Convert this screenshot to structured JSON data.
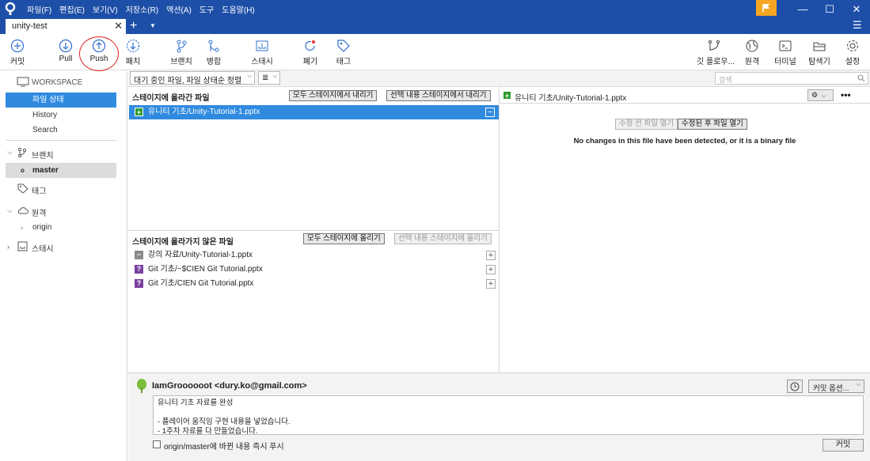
{
  "menu": [
    "파일(F)",
    "편집(E)",
    "보기(V)",
    "저장소(R)",
    "액션(A)",
    "도구",
    "도움말(H)"
  ],
  "window": {
    "minimize": "—",
    "maximize": "☐",
    "close": "✕"
  },
  "tab": {
    "title": "unity-test",
    "close": "✕",
    "add": "+",
    "dropdown": "▼"
  },
  "toolbar": {
    "commit": "커밋",
    "pull": "Pull",
    "push": "Push",
    "fetch": "패치",
    "branch": "브랜치",
    "merge": "병합",
    "stash": "스태시",
    "discard": "폐기",
    "tag": "태그",
    "gitflow": "깃 플로우...",
    "remote": "원격",
    "terminal": "터미널",
    "explorer": "탐색기",
    "settings": "설정"
  },
  "sidebar": {
    "workspace": "WORKSPACE",
    "file_status": "파일 상태",
    "history": "History",
    "search": "Search",
    "branches": "브랜치",
    "master": "master",
    "tags": "태그",
    "remotes": "원격",
    "origin": "origin",
    "stashes": "스태시"
  },
  "filter": {
    "mode": "대기 중인 파일, 파일 상태순 정렬",
    "view": "≣",
    "search_placeholder": "검색"
  },
  "staged": {
    "header": "스테이지에 올라간 파일",
    "unstage_all": "모두 스테이지에서 내리기",
    "unstage_selected": "선택 내용 스테이지에서 내리기",
    "files": [
      {
        "name": "유니티 기초/Unity-Tutorial-1.pptx",
        "status": "added"
      }
    ]
  },
  "unstaged": {
    "header": "스테이지에 올라가지 않은 파일",
    "stage_all": "모두 스테이지에 올리기",
    "stage_selected": "선택 내용 스테이지에 올리기",
    "files": [
      {
        "name": "강의 자료/Unity-Tutorial-1.pptx",
        "status": "modified"
      },
      {
        "name": "Git 기초/~$CIEN Git Tutorial.pptx",
        "status": "untracked"
      },
      {
        "name": "Git 기초/CIEN Git Tutorial.pptx",
        "status": "untracked"
      }
    ]
  },
  "diff": {
    "file": "유니티 기초/Unity-Tutorial-1.pptx",
    "open_before": "수정 전 파일 열기",
    "open_after": "수정된 후 파일 열기",
    "message": "No changes in this file have been detected, or it is a binary file"
  },
  "commit": {
    "author": "IamGroooooot <dury.ko@gmail.com>",
    "message": "유니티 기초 자료를 완성\n\n- 플레이어 움직임 구현 내용을 넣었습니다.\n- 1주차 자료를 다 만들었습니다.",
    "options": "커밋 옵션...",
    "push_checkbox": "origin/master에 바뀐 내용 즉시 푸시",
    "commit_button": "커밋"
  },
  "colors": {
    "titlebar": "#1e4fa8",
    "selection": "#2f8ae0",
    "push_highlight": "#e02020",
    "flag": "#f5a623"
  }
}
